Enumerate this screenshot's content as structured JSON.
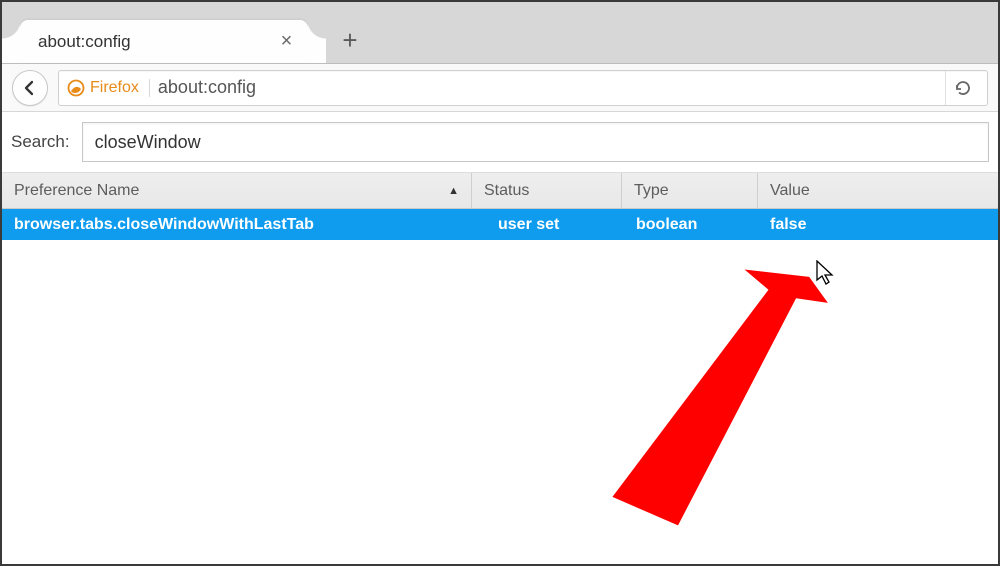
{
  "tab": {
    "title": "about:config",
    "close_glyph": "×",
    "new_glyph": "+"
  },
  "toolbar": {
    "back_icon": "←",
    "identity_label": "Firefox",
    "url": "about:config",
    "reload_glyph": "↻"
  },
  "search": {
    "label": "Search:",
    "value": "closeWindow"
  },
  "headers": {
    "name": "Preference Name",
    "status": "Status",
    "type": "Type",
    "value": "Value",
    "sort_indicator": "▲"
  },
  "rows": [
    {
      "name": "browser.tabs.closeWindowWithLastTab",
      "status": "user set",
      "type": "boolean",
      "value": "false"
    }
  ],
  "colors": {
    "selected_row_bg": "#0f9cee",
    "firefox_orange": "#e88b19",
    "arrow_red": "#ff0000"
  }
}
